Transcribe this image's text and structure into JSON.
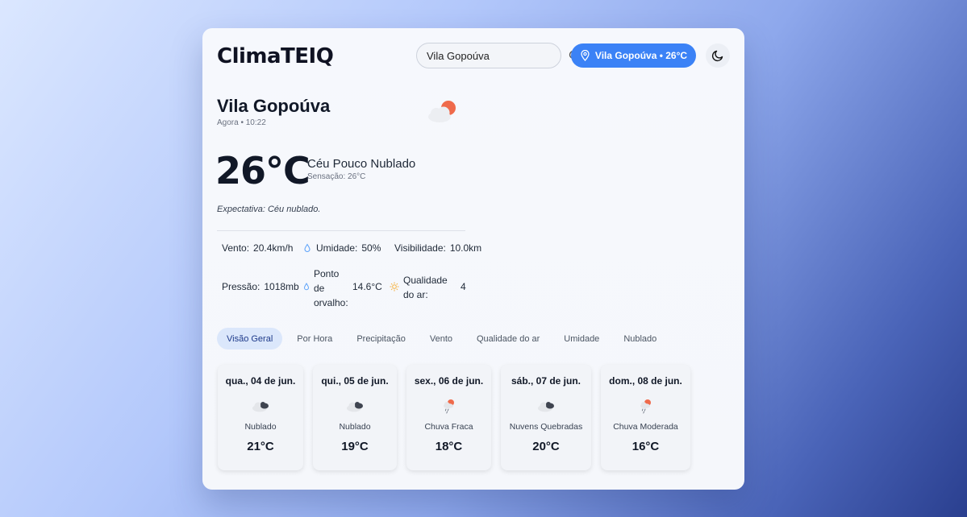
{
  "app": {
    "logo": "ClimaTEIQ"
  },
  "header": {
    "search_value": "Vila Gopoúva",
    "location_button": "Vila Gopoúva • 26°C"
  },
  "current": {
    "city": "Vila Gopoúva",
    "time": "Agora • 10:22",
    "temperature": "26°C",
    "description": "Céu Pouco Nublado",
    "feels_like": "Sensação: 26°C",
    "expectation": "Expectativa: Céu nublado."
  },
  "stats": {
    "wind_label": "Vento:",
    "wind_value": "20.4km/h",
    "humidity_label": "Umidade:",
    "humidity_value": "50%",
    "visibility_label": "Visibilidade:",
    "visibility_value": "10.0km",
    "pressure_label": "Pressão:",
    "pressure_value": "1018mb",
    "dew_label_1": "Ponto",
    "dew_label_2": "de",
    "dew_label_3": "orvalho:",
    "dew_value": "14.6°C",
    "air_label_1": "Qualidade",
    "air_label_2": "do ar:",
    "air_value": "4"
  },
  "tabs": [
    "Visão Geral",
    "Por Hora",
    "Precipitação",
    "Vento",
    "Qualidade do ar",
    "Umidade",
    "Nublado"
  ],
  "forecast": [
    {
      "date": "qua., 04 de jun.",
      "condition": "Nublado",
      "temp": "21°C",
      "icon": "cloudy-icon"
    },
    {
      "date": "qui., 05 de jun.",
      "condition": "Nublado",
      "temp": "19°C",
      "icon": "cloudy-icon"
    },
    {
      "date": "sex., 06 de jun.",
      "condition": "Chuva Fraca",
      "temp": "18°C",
      "icon": "rain-sun-icon"
    },
    {
      "date": "sáb., 07 de jun.",
      "condition": "Nuvens Quebradas",
      "temp": "20°C",
      "icon": "cloudy-icon"
    },
    {
      "date": "dom., 08 de jun.",
      "condition": "Chuva Moderada",
      "temp": "16°C",
      "icon": "rain-sun-icon"
    }
  ],
  "colors": {
    "accent": "#3b82f6",
    "sun": "#ef6a4b",
    "active_tab": "#dbe7fb"
  }
}
